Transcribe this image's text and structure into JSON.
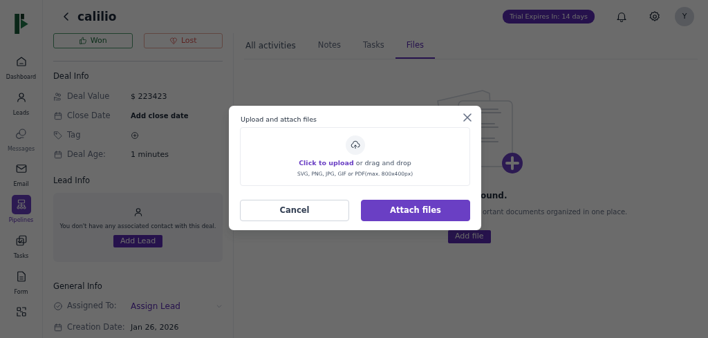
{
  "sidebar": {
    "items": [
      {
        "label": "Dashboard",
        "selected": false,
        "disabled": false
      },
      {
        "label": "Leads",
        "selected": false,
        "disabled": false
      },
      {
        "label": "Messages",
        "selected": false,
        "disabled": true
      },
      {
        "label": "Email",
        "selected": false,
        "disabled": false
      },
      {
        "label": "Pipelines",
        "selected": true,
        "disabled": false
      },
      {
        "label": "Tasks",
        "selected": false,
        "disabled": false
      },
      {
        "label": "Form",
        "selected": false,
        "disabled": false
      },
      {
        "selected": false,
        "disabled": false
      }
    ]
  },
  "header": {
    "title": "calilio",
    "trial_badge": "Trial Expires In: 14 days",
    "avatar": "Y"
  },
  "outcome_buttons": [
    {
      "label": "Won",
      "kind": "won"
    },
    {
      "label": "Lost",
      "kind": "lost"
    }
  ],
  "deal_info": {
    "title": "Deal Info",
    "rows": [
      {
        "label": "Deal Value",
        "value": "$ 223423",
        "kind": "text"
      },
      {
        "label": "Close Date",
        "value": "Add close date",
        "kind": "action"
      },
      {
        "label": "Tag",
        "kind": "add"
      },
      {
        "label": "Deal Age:",
        "value": "1 minutes",
        "kind": "text"
      }
    ]
  },
  "lead_info": {
    "title": "Lead Info",
    "message": "You don't have any associated contact with this deal.",
    "button": "Add Lead"
  },
  "general_info": {
    "title": "General Info",
    "rows": [
      {
        "label": "Assigned To:",
        "value": "Assign Lead",
        "kind": "select"
      },
      {
        "label": "Creation Date:",
        "value": "Jan 26, 2026",
        "kind": "text"
      }
    ]
  },
  "tabs": [
    {
      "label": "All activities",
      "selected": false
    },
    {
      "label": "Notes",
      "selected": false
    },
    {
      "label": "Tasks",
      "selected": false
    },
    {
      "label": "Files",
      "selected": true
    }
  ],
  "empty_state": {
    "title": "ound.",
    "text": "ortant documents organized in one place.",
    "button": "Add file"
  },
  "modal": {
    "title": "Upload and attach files",
    "upload_link": "Click to upload",
    "upload_text": "or drag and drop",
    "hint": "SVG, PNG, JPG, GIF or PDF(max. 800x400px)",
    "buttons": [
      {
        "label": "Cancel",
        "kind": "secondary"
      },
      {
        "label": "Attach files",
        "kind": "primary"
      }
    ]
  }
}
